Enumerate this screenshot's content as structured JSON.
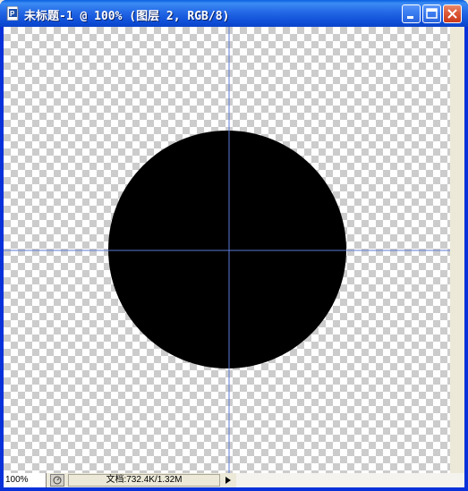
{
  "window": {
    "title": "未标题-1 @ 100% (图层 2, RGB/8)"
  },
  "titlebar_buttons": {
    "minimize_icon": "minimize-icon",
    "maximize_icon": "maximize-icon",
    "close_icon": "close-icon"
  },
  "canvas": {
    "shape": "black filled circle on transparent checkerboard",
    "fill_color": "#000000",
    "guide_color": "#5b7ad6",
    "checker_colors": [
      "#ffffff",
      "#cccccc"
    ]
  },
  "status": {
    "zoom": "100%",
    "doc_info": "文档:732.4K/1.32M"
  }
}
